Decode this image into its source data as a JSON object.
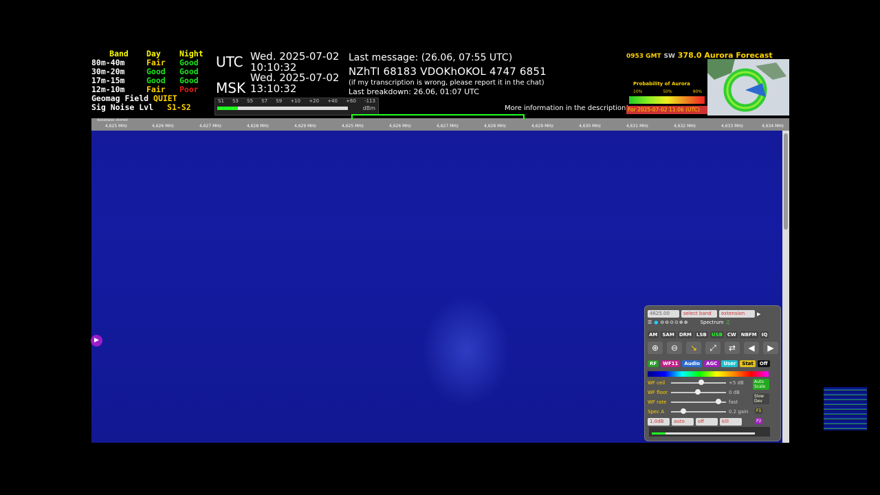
{
  "band_table": {
    "headers": [
      "Band",
      "Day",
      "Night"
    ],
    "rows": [
      {
        "band": "80m-40m",
        "day": "Fair",
        "night": "Good"
      },
      {
        "band": "30m-20m",
        "day": "Good",
        "night": "Good"
      },
      {
        "band": "17m-15m",
        "day": "Good",
        "night": "Good"
      },
      {
        "band": "12m-10m",
        "day": "Fair",
        "night": "Poor"
      }
    ],
    "geomag_label": "Geomag Field",
    "geomag_value": "QUIET",
    "signoise_label": "Sig Noise Lvl",
    "signoise_value": "S1-S2"
  },
  "clock": {
    "utc_label": "UTC",
    "utc_date": "Wed. 2025-07-02",
    "utc_time": "10:10:32",
    "msk_label": "MSK",
    "msk_date": "Wed. 2025-07-02",
    "msk_time": "13:10:32"
  },
  "message": {
    "last_message": "Last message: (26.06, 07:55 UTC)",
    "content": "NZhTI 68183 VDOKhOKOL 4747 6851",
    "note": "(if my transcription is wrong, please report it in the chat)",
    "breakdown": "Last breakdown: 26.06, 01:07 UTC",
    "more_info": "More information in the description!"
  },
  "smeter": {
    "ticks": [
      "S1",
      "S3",
      "S5",
      "S7",
      "S9",
      "+10",
      "+20",
      "+40",
      "+60",
      "-113"
    ],
    "unit": "dBm"
  },
  "aurora": {
    "code": "0953 GMT",
    "sw": "SW",
    "value": "378.0",
    "title": "Aurora Forecast",
    "prob_label": "Probability of Aurora",
    "pct": [
      "10%",
      "50%",
      "90%"
    ],
    "for_label": "For 2025-07-02 11:06 (UTC)"
  },
  "scale": {
    "db_label": "database stored",
    "labels": [
      "4,625 MHz",
      "4,626 MHz",
      "4,627 MHz",
      "4,628 MHz",
      "4,629 MHz",
      "4,625 MHz",
      "4,626 MHz",
      "4,627 MHz",
      "4,628 MHz",
      "4,629 MHz",
      "4,630 MHz",
      "4,631 MHz",
      "4,632 MHz",
      "4,633 MHz",
      "4,634 MHz"
    ]
  },
  "controls": {
    "freq": "4625.00",
    "select_band": "select band",
    "extension": "extension",
    "spectrum": "Spectrum",
    "modes": [
      "AM",
      "SAM",
      "DRM",
      "LSB",
      "USB",
      "CW",
      "NBFM",
      "IQ"
    ],
    "active_mode": "USB",
    "tags": [
      {
        "label": "RF",
        "bg": "#2a9a2a",
        "fg": "#ffffff"
      },
      {
        "label": "WF11",
        "bg": "#c0208a",
        "fg": "#ffffff"
      },
      {
        "label": "Audio",
        "bg": "#2a6ad0",
        "fg": "#ffffff"
      },
      {
        "label": "AGC",
        "bg": "#a020c0",
        "fg": "#ffffff"
      },
      {
        "label": "User",
        "bg": "#20c0d0",
        "fg": "#ffffff"
      },
      {
        "label": "Stat",
        "bg": "#e0c020",
        "fg": "#000000"
      },
      {
        "label": "Off",
        "bg": "#111111",
        "fg": "#ffffff"
      }
    ],
    "sliders": [
      {
        "label": "WF ceil",
        "value": "+5 dB",
        "level": 0.55
      },
      {
        "label": "WF floor",
        "value": "0 dB",
        "level": 0.48
      },
      {
        "label": "WF rate",
        "value": "fast",
        "level": 0.9
      },
      {
        "label": "Spec A",
        "value": "0.2 gain",
        "level": 0.2
      }
    ],
    "auto_scale": "Auto Scale",
    "slow_dev": "Slow Dev",
    "f1": "F1",
    "f2": "P2",
    "bottom_selects": [
      "1.0dB",
      "auto",
      "off",
      "kill"
    ]
  }
}
